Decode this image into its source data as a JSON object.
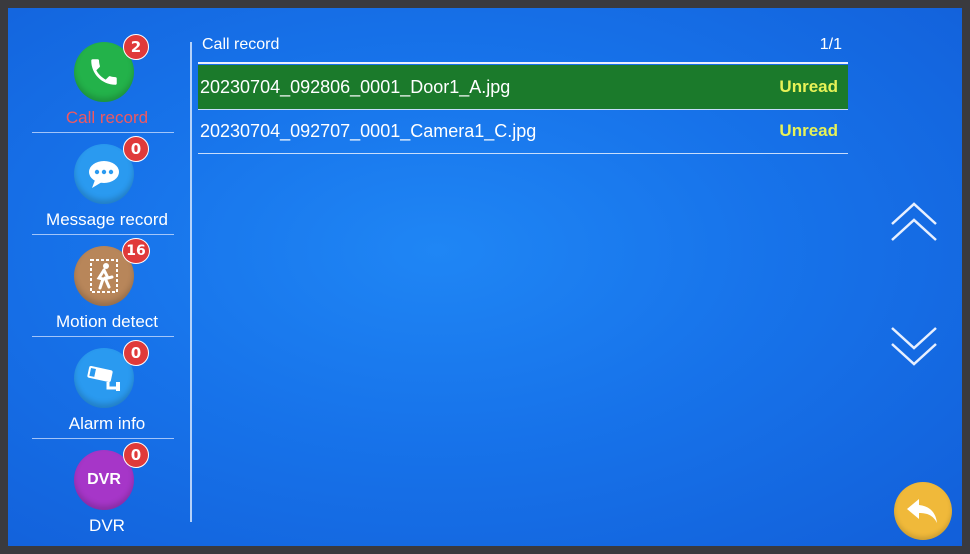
{
  "sidebar": {
    "items": [
      {
        "label": "Call record",
        "badge": "2",
        "icon": "phone-icon",
        "color": "#23b24a",
        "active": true
      },
      {
        "label": "Message record",
        "badge": "0",
        "icon": "chat-bubble-icon",
        "color": "#2a9af0",
        "active": false
      },
      {
        "label": "Motion detect",
        "badge": "16",
        "icon": "running-person-icon",
        "color": "#b8865a",
        "active": false
      },
      {
        "label": "Alarm info",
        "badge": "0",
        "icon": "cctv-camera-icon",
        "color": "#2a9af0",
        "active": false
      },
      {
        "label": "DVR",
        "badge": "0",
        "icon_text": "DVR",
        "color": "#a636c8",
        "active": false
      }
    ]
  },
  "list": {
    "title": "Call record",
    "page": "1/1",
    "rows": [
      {
        "filename": "20230704_092806_0001_Door1_A.jpg",
        "status": "Unread",
        "selected": true
      },
      {
        "filename": "20230704_092707_0001_Camera1_C.jpg",
        "status": "Unread",
        "selected": false
      }
    ]
  },
  "controls": {
    "up_icon": "chevron-double-up-icon",
    "down_icon": "chevron-double-down-icon",
    "back_icon": "return-arrow-icon"
  },
  "colors": {
    "background": "#1773ea",
    "selected_row": "#1b7a2b",
    "status_text": "#e7f257",
    "active_label": "#f0595f",
    "badge": "#e03a3a",
    "back_button": "#f0b93a"
  }
}
